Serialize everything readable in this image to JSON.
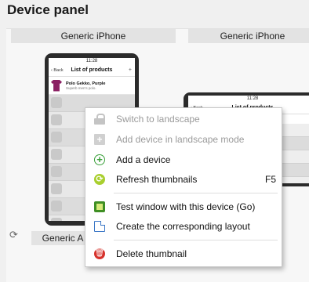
{
  "panel": {
    "title": "Device panel"
  },
  "cards": [
    {
      "label": "Generic iPhone"
    },
    {
      "label": "Generic iPhone"
    },
    {
      "label": "Generic A"
    }
  ],
  "phone_portrait": {
    "time": "11:28",
    "back": "Back",
    "title": "List of products",
    "plus": "+",
    "product_name": "Polo Gekko, Purple",
    "product_desc": "Superb men's polo."
  },
  "phone_landscape": {
    "time": "11:28",
    "back": "Back",
    "title": "List of products"
  },
  "menu": {
    "items": [
      {
        "label": "Switch to landscape",
        "icon": "lock-icon",
        "disabled": true
      },
      {
        "label": "Add device in landscape mode",
        "icon": "add-landscape-icon",
        "disabled": true
      },
      {
        "label": "Add a device",
        "icon": "add-circle-icon",
        "disabled": false
      },
      {
        "label": "Refresh thumbnails",
        "shortcut": "F5",
        "icon": "refresh-icon",
        "disabled": false
      },
      {
        "label": "Test window with this device (Go)",
        "icon": "test-window-icon",
        "disabled": false
      },
      {
        "label": "Create the corresponding layout",
        "icon": "layout-icon",
        "disabled": false
      },
      {
        "label": "Delete thumbnail",
        "icon": "delete-icon",
        "disabled": false
      }
    ]
  },
  "colors": {
    "accent_green": "#3aa03a",
    "refresh_green": "#a9cf2e",
    "delete_red": "#d6322c",
    "layout_blue": "#3a76c6",
    "product_purple": "#8b1f63"
  }
}
